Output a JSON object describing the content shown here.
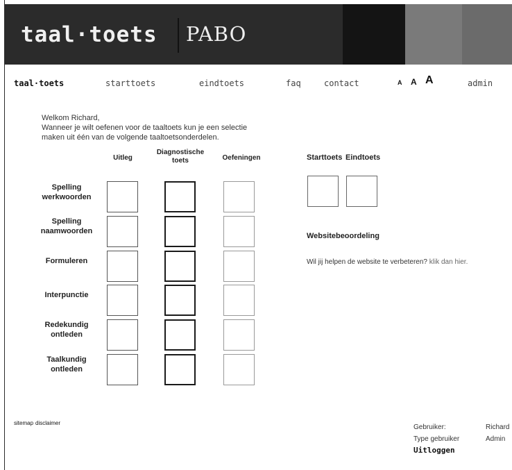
{
  "header": {
    "logo_main": "taal·toets",
    "logo_sub": "PABO"
  },
  "nav": {
    "brand": "taal·toets",
    "items": [
      {
        "label": "starttoets"
      },
      {
        "label": "eindtoets"
      },
      {
        "label": "faq"
      },
      {
        "label": "contact"
      }
    ],
    "font_sizes": [
      "A",
      "A",
      "A"
    ],
    "admin": "admin"
  },
  "welcome": {
    "greeting": "Welkom Richard,",
    "line1": "Wanneer je wilt oefenen voor de taaltoets kun je een selectie",
    "line2": "maken uit één van de volgende taaltoetsonderdelen."
  },
  "table": {
    "columns": {
      "uitleg": "Uitleg",
      "diag1": "Diagnostische",
      "diag2": "toets",
      "oefeningen": "Oefeningen"
    },
    "rows": [
      {
        "l1": "Spelling",
        "l2": "werkwoorden"
      },
      {
        "l1": "Spelling",
        "l2": "naamwoorden"
      },
      {
        "l1": "Formuleren",
        "l2": ""
      },
      {
        "l1": "Interpunctie",
        "l2": ""
      },
      {
        "l1": "Redekundig",
        "l2": "ontleden"
      },
      {
        "l1": "Taalkundig",
        "l2": "ontleden"
      }
    ]
  },
  "right": {
    "starttoets": "Starttoets",
    "eindtoets": "Eindtoets",
    "website_heading": "Websitebeoordeling",
    "improve_text": "Wil jij helpen de website te verbeteren?",
    "improve_link": "klik dan hier."
  },
  "footer": {
    "links": [
      "sitemap",
      "disclaimer"
    ],
    "user_label": "Gebruiker:",
    "user_value": "Richard",
    "type_label": "Type gebruiker",
    "type_value": "Admin",
    "logout": "Uitloggen"
  }
}
